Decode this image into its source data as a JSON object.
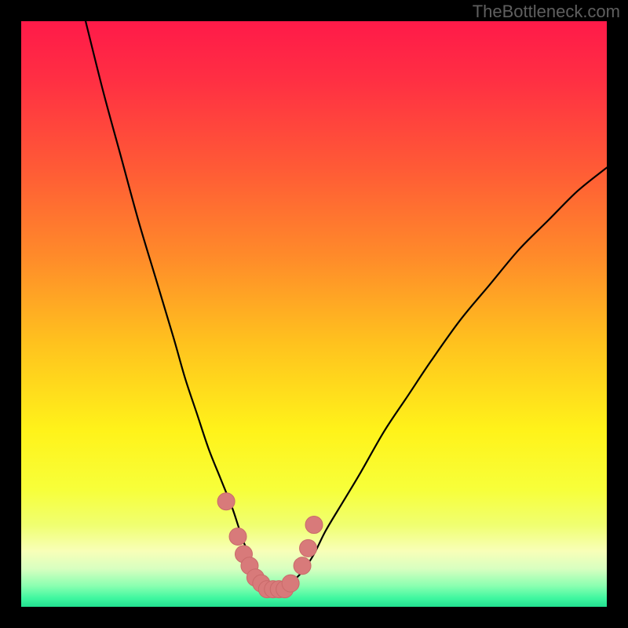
{
  "watermark": "TheBottleneck.com",
  "colors": {
    "frame": "#000000",
    "curve": "#000000",
    "marker_fill": "#d87a7a",
    "marker_stroke": "#c96a6a",
    "gradient_stops": [
      {
        "offset": 0.0,
        "color": "#ff1a49"
      },
      {
        "offset": 0.1,
        "color": "#ff2f43"
      },
      {
        "offset": 0.25,
        "color": "#ff5a36"
      },
      {
        "offset": 0.4,
        "color": "#ff8a2a"
      },
      {
        "offset": 0.55,
        "color": "#ffc21e"
      },
      {
        "offset": 0.7,
        "color": "#fff31a"
      },
      {
        "offset": 0.8,
        "color": "#f7ff3a"
      },
      {
        "offset": 0.86,
        "color": "#f0ff70"
      },
      {
        "offset": 0.905,
        "color": "#f8ffb8"
      },
      {
        "offset": 0.935,
        "color": "#d8ffc0"
      },
      {
        "offset": 0.965,
        "color": "#88ffb0"
      },
      {
        "offset": 0.985,
        "color": "#40f7a0"
      },
      {
        "offset": 1.0,
        "color": "#22e090"
      }
    ]
  },
  "chart_data": {
    "type": "line",
    "title": "",
    "xlabel": "",
    "ylabel": "",
    "xlim": [
      0,
      100
    ],
    "ylim": [
      0,
      100
    ],
    "series": [
      {
        "name": "bottleneck-curve",
        "x": [
          11,
          14,
          17,
          20,
          23,
          26,
          28,
          30,
          32,
          34,
          36,
          37,
          38,
          39,
          40,
          41,
          42,
          43,
          44,
          45,
          46,
          48,
          50,
          52,
          55,
          58,
          62,
          66,
          70,
          75,
          80,
          85,
          90,
          95,
          100
        ],
        "y": [
          100,
          88,
          77,
          66,
          56,
          46,
          39,
          33,
          27,
          22,
          17,
          14,
          11,
          9,
          7,
          5,
          4,
          3,
          3,
          3,
          4,
          6,
          9,
          13,
          18,
          23,
          30,
          36,
          42,
          49,
          55,
          61,
          66,
          71,
          75
        ]
      }
    ],
    "markers": {
      "name": "highlight-points",
      "x": [
        35,
        37,
        38,
        39,
        40,
        41,
        42,
        43,
        44,
        45,
        46,
        48,
        49,
        50
      ],
      "y": [
        18,
        12,
        9,
        7,
        5,
        4,
        3,
        3,
        3,
        3,
        4,
        7,
        10,
        14
      ]
    }
  }
}
